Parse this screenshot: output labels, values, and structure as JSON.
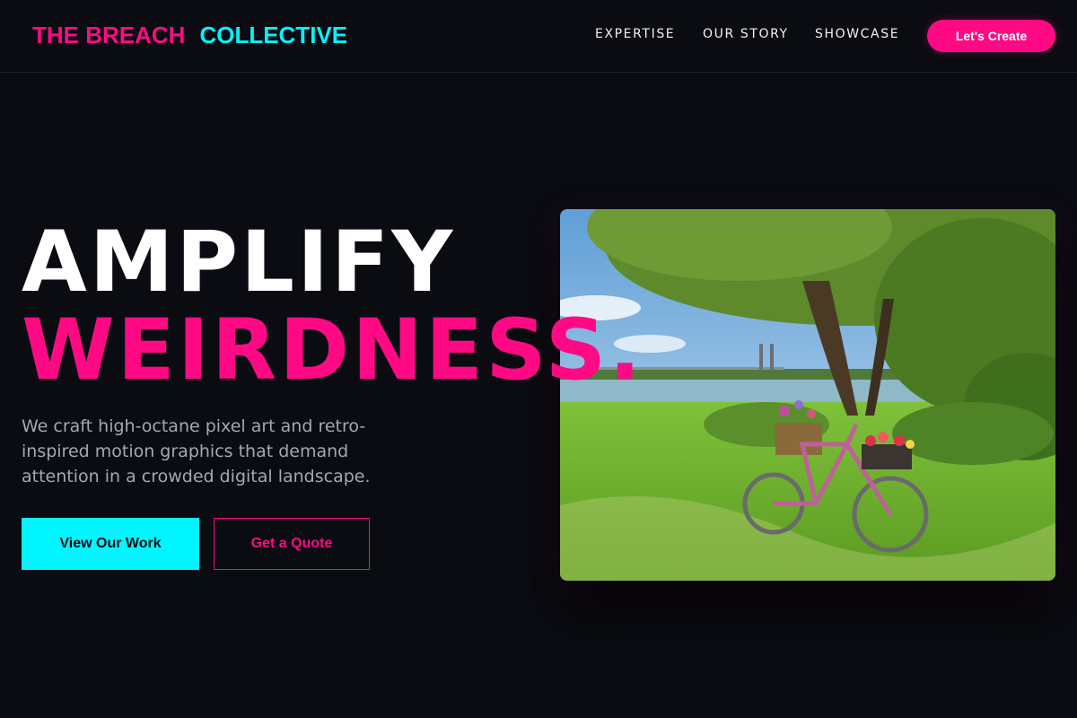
{
  "brand": {
    "part1": "THE BREACH",
    "part2": "COLLECTIVE"
  },
  "nav": {
    "items": [
      "EXPERTISE",
      "OUR STORY",
      "SHOWCASE"
    ],
    "cta": "Let's Create"
  },
  "hero": {
    "title_line1": "AMPLIFY",
    "title_line2": "WEIRDNESS.",
    "subtitle": "We craft high-octane pixel art and retro-inspired motion graphics that demand attention in a crowded digital landscape.",
    "primary_button": "View Our Work",
    "secondary_button": "Get a Quote"
  },
  "colors": {
    "background": "#0a0c12",
    "accent_pink": "#ff0a84",
    "accent_cyan": "#00f5ff"
  }
}
